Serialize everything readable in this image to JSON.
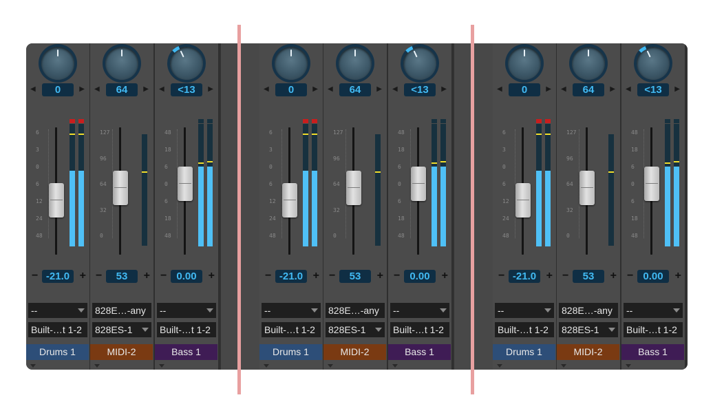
{
  "groups": [
    {
      "channels": [
        {
          "name": "Drums 1",
          "name_bg": "#2d4e78",
          "pan": "0",
          "volume": "-21.0",
          "input": "--",
          "output": "Built-…t 1-2",
          "scale": [
            "6",
            "3",
            "0",
            "6",
            "12",
            "24",
            "48"
          ],
          "stereo": true,
          "clip": true,
          "level": 0.62,
          "fader": 0.4
        },
        {
          "name": "MIDI-2",
          "name_bg": "#7a3a12",
          "pan": "64",
          "volume": "53",
          "input": "828E…-any",
          "output": "828ES-1",
          "scale": [
            "127",
            "96",
            "64",
            "32",
            "0"
          ],
          "stereo": false,
          "clip": false,
          "level": 0.64,
          "fader": 0.53
        },
        {
          "name": "Bass 1",
          "name_bg": "#3f1c55",
          "pan": "<13",
          "volume": "0.00",
          "input": "--",
          "output": "Built-…t 1-2",
          "scale": [
            "48",
            "18",
            "6",
            "0",
            "6",
            "18",
            "48"
          ],
          "stereo": true,
          "clip": false,
          "level": 0.65,
          "fader": 0.58
        }
      ]
    },
    {
      "channels": [
        {
          "name": "Drums 1",
          "name_bg": "#2d4e78",
          "pan": "0",
          "volume": "-21.0",
          "input": "--",
          "output": "Built-…t 1-2",
          "scale": [
            "6",
            "3",
            "0",
            "6",
            "12",
            "24",
            "48"
          ],
          "stereo": true,
          "clip": true,
          "level": 0.62,
          "fader": 0.4
        },
        {
          "name": "MIDI-2",
          "name_bg": "#7a3a12",
          "pan": "64",
          "volume": "53",
          "input": "828E…-any",
          "output": "828ES-1",
          "scale": [
            "127",
            "96",
            "64",
            "32",
            "0"
          ],
          "stereo": false,
          "clip": false,
          "level": 0.64,
          "fader": 0.53
        },
        {
          "name": "Bass 1",
          "name_bg": "#3f1c55",
          "pan": "<13",
          "volume": "0.00",
          "input": "--",
          "output": "Built-…t 1-2",
          "scale": [
            "48",
            "18",
            "6",
            "0",
            "6",
            "18",
            "48"
          ],
          "stereo": true,
          "clip": false,
          "level": 0.65,
          "fader": 0.58
        }
      ]
    },
    {
      "channels": [
        {
          "name": "Drums 1",
          "name_bg": "#2d4e78",
          "pan": "0",
          "volume": "-21.0",
          "input": "--",
          "output": "Built-…t 1-2",
          "scale": [
            "6",
            "3",
            "0",
            "6",
            "12",
            "24",
            "48"
          ],
          "stereo": true,
          "clip": true,
          "level": 0.62,
          "fader": 0.4
        },
        {
          "name": "MIDI-2",
          "name_bg": "#7a3a12",
          "pan": "64",
          "volume": "53",
          "input": "828E…-any",
          "output": "828ES-1",
          "scale": [
            "127",
            "96",
            "64",
            "32",
            "0"
          ],
          "stereo": false,
          "clip": false,
          "level": 0.64,
          "fader": 0.53
        },
        {
          "name": "Bass 1",
          "name_bg": "#3f1c55",
          "pan": "<13",
          "volume": "0.00",
          "input": "--",
          "output": "Built-…t 1-2",
          "scale": [
            "48",
            "18",
            "6",
            "0",
            "6",
            "18",
            "48"
          ],
          "stereo": true,
          "clip": false,
          "level": 0.65,
          "fader": 0.58
        }
      ]
    }
  ],
  "colors": {
    "value_text": "#41b9f2",
    "meter": "#4fc0f6",
    "peak": "#f2dd2a",
    "clip": "#c81e1e",
    "divider": "#e8a0a0"
  },
  "icons": {
    "pan_left": "triangle-left-icon",
    "pan_right": "triangle-right-icon",
    "minus": "minus-icon",
    "plus": "plus-icon",
    "dropdown": "chevron-down-icon"
  }
}
